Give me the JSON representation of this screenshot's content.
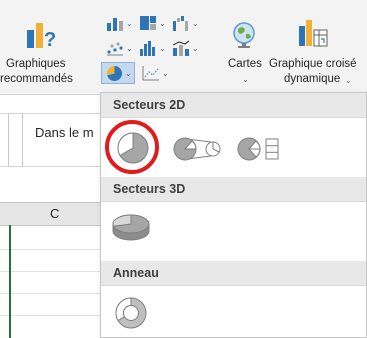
{
  "ribbon": {
    "recommended_charts_line1": "Graphiques",
    "recommended_charts_line2": "recommandés",
    "maps_label": "Cartes",
    "pivot_chart_line1": "Graphique croisé",
    "pivot_chart_line2": "dynamique",
    "icons": [
      "recommended-charts-icon",
      "column-chart-icon",
      "hierarchy-chart-icon",
      "waterfall-chart-icon",
      "scatter-chart-icon",
      "statistic-chart-icon",
      "combo-chart-icon",
      "pie-chart-icon",
      "area-chart-icon",
      "maps-globe-icon",
      "pivot-chart-icon"
    ]
  },
  "formula_bar": {
    "text": "Dans le m"
  },
  "sheet": {
    "column_c": "C"
  },
  "menu": {
    "sections": [
      {
        "title": "Secteurs 2D",
        "options": [
          "pie-2d-icon",
          "pie-of-pie-icon",
          "bar-of-pie-icon"
        ]
      },
      {
        "title": "Secteurs 3D",
        "options": [
          "pie-3d-icon"
        ]
      },
      {
        "title": "Anneau",
        "options": [
          "doughnut-icon"
        ]
      }
    ]
  },
  "colors": {
    "highlight": "#e11b1b",
    "excel_green": "#217346",
    "chart_blue": "#2e75b6",
    "chart_gray": "#a6a6a6"
  }
}
